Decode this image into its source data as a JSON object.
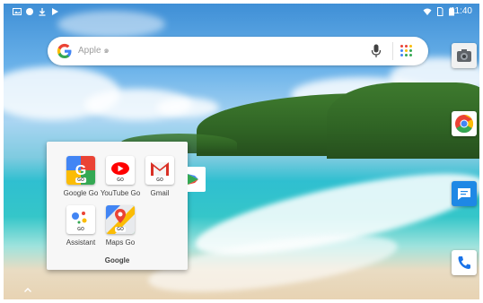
{
  "status_bar": {
    "time": "11:40",
    "left_icons": [
      "image-icon",
      "circle-icon",
      "download-icon",
      "play-store-notification-icon"
    ],
    "right_icons": [
      "wifi-icon",
      "sim-icon",
      "battery-icon"
    ]
  },
  "search_bar": {
    "placeholder": "Apple ๑",
    "icons": [
      "google-g-icon",
      "mic-icon",
      "apps-grid-icon"
    ]
  },
  "folder": {
    "title": "Google",
    "apps": [
      {
        "label": "Google Go",
        "icon": "google-go-icon",
        "tag": "GO"
      },
      {
        "label": "YouTube Go",
        "icon": "youtube-go-icon",
        "tag": "GO"
      },
      {
        "label": "Gmail",
        "icon": "gmail-icon",
        "tag": "GO"
      },
      {
        "label": "Assistant",
        "icon": "assistant-icon",
        "tag": "GO"
      },
      {
        "label": "Maps Go",
        "icon": "maps-go-icon",
        "tag": "GO"
      }
    ]
  },
  "dock_icons": [
    "camera-icon",
    "chrome-icon",
    "messages-icon",
    "phone-icon"
  ],
  "colors": {
    "google_blue": "#4285f4",
    "google_red": "#ea4335",
    "google_yellow": "#fbbc05",
    "google_green": "#34a853",
    "messages_blue": "#1e88e5",
    "phone_blue": "#1a73e8",
    "folder_bg": "#f7f7f7"
  }
}
